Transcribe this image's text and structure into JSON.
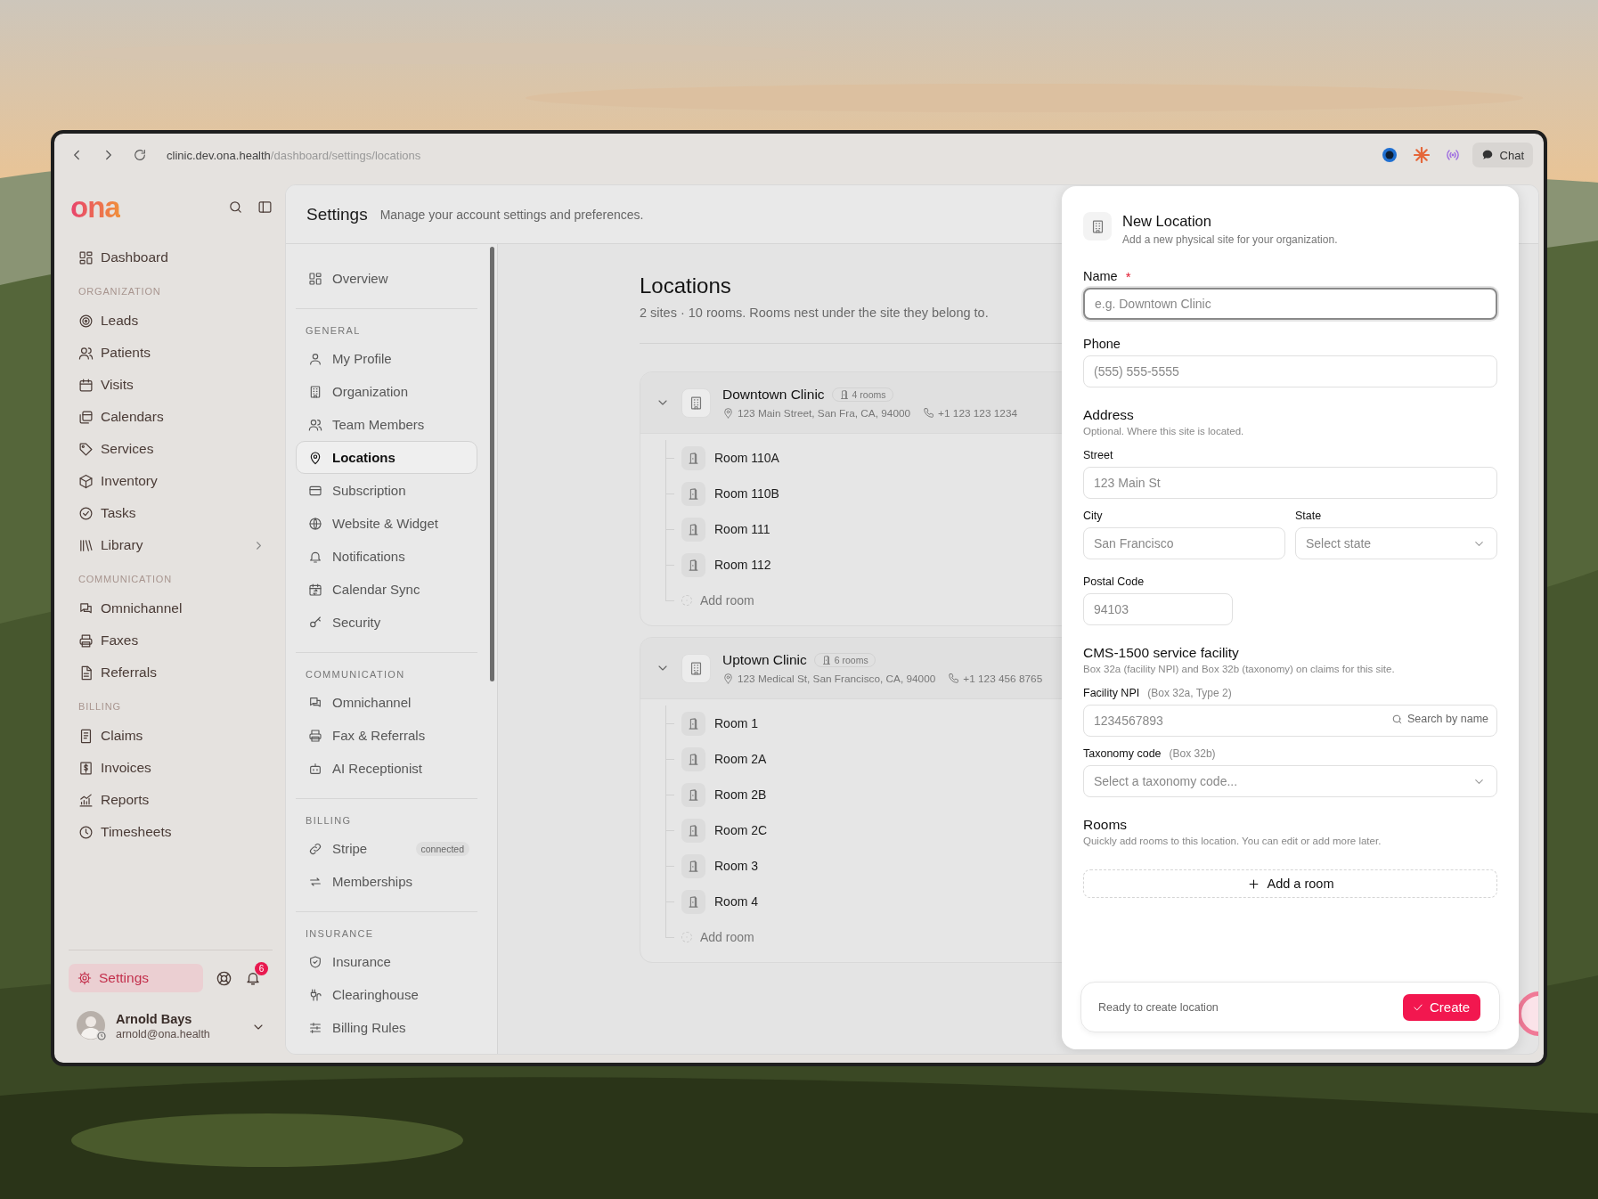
{
  "browser": {
    "url_host": "clinic.dev.ona.health",
    "url_path": "/dashboard/settings/locations",
    "chat_button": "Chat"
  },
  "sidebar": {
    "logo": "ona",
    "sections": [
      {
        "items": [
          {
            "label": "Dashboard",
            "kind": "link"
          }
        ]
      },
      {
        "heading": "ORGANIZATION",
        "items": [
          {
            "label": "Leads",
            "kind": "link"
          },
          {
            "label": "Patients",
            "kind": "link"
          },
          {
            "label": "Visits",
            "kind": "link"
          },
          {
            "label": "Calendars",
            "kind": "link"
          },
          {
            "label": "Services",
            "kind": "link"
          },
          {
            "label": "Inventory",
            "kind": "link"
          },
          {
            "label": "Tasks",
            "kind": "link"
          },
          {
            "label": "Library",
            "kind": "submenu"
          }
        ]
      },
      {
        "heading": "COMMUNICATION",
        "items": [
          {
            "label": "Omnichannel",
            "kind": "link"
          },
          {
            "label": "Faxes",
            "kind": "link"
          },
          {
            "label": "Referrals",
            "kind": "link"
          }
        ]
      },
      {
        "heading": "BILLING",
        "items": [
          {
            "label": "Claims",
            "kind": "link"
          },
          {
            "label": "Invoices",
            "kind": "link"
          },
          {
            "label": "Reports",
            "kind": "link"
          },
          {
            "label": "Timesheets",
            "kind": "link"
          }
        ]
      }
    ],
    "settings": {
      "label": "Settings",
      "selected": true
    },
    "notifications": "6",
    "user": {
      "name": "Arnold Bays",
      "email": "arnold@ona.health"
    }
  },
  "header": {
    "title": "Settings",
    "description": "Manage your account settings and preferences."
  },
  "settings_nav": {
    "sections": [
      {
        "items": [
          {
            "label": "Overview",
            "selected": false
          }
        ]
      },
      {
        "heading": "GENERAL",
        "items": [
          {
            "label": "My Profile",
            "selected": false
          },
          {
            "label": "Organization",
            "selected": false
          },
          {
            "label": "Team Members",
            "selected": false
          },
          {
            "label": "Locations",
            "selected": true
          },
          {
            "label": "Subscription",
            "selected": false
          },
          {
            "label": "Website & Widget",
            "selected": false
          },
          {
            "label": "Notifications",
            "selected": false
          },
          {
            "label": "Calendar Sync",
            "selected": false
          },
          {
            "label": "Security",
            "selected": false
          }
        ]
      },
      {
        "heading": "COMMUNICATION",
        "items": [
          {
            "label": "Omnichannel",
            "selected": false
          },
          {
            "label": "Fax & Referrals",
            "selected": false
          },
          {
            "label": "AI Receptionist",
            "selected": false
          }
        ]
      },
      {
        "heading": "BILLING",
        "items": [
          {
            "label": "Stripe",
            "selected": false,
            "badge": "connected"
          },
          {
            "label": "Memberships",
            "selected": false
          }
        ]
      },
      {
        "heading": "INSURANCE",
        "items": [
          {
            "label": "Insurance",
            "selected": false
          },
          {
            "label": "Clearinghouse",
            "selected": false
          },
          {
            "label": "Billing Rules",
            "selected": false
          }
        ]
      }
    ]
  },
  "locations": {
    "title": "Locations",
    "subtitle": "2 sites · 10 rooms. Rooms nest under the site they belong to.",
    "sites": [
      {
        "name": "Downtown Clinic",
        "room_count": "4 rooms",
        "address": "123 Main Street, San Fra, CA, 94000",
        "phone": "+1 123 123 1234",
        "expanded": true,
        "rooms": [
          "Room 110A",
          "Room 110B",
          "Room 111",
          "Room 112"
        ],
        "add_room": "Add room"
      },
      {
        "name": "Uptown Clinic",
        "room_count": "6 rooms",
        "address": "123 Medical St, San Francisco, CA, 94000",
        "phone": "+1 123 456 8765",
        "expanded": true,
        "rooms": [
          "Room 1",
          "Room 2A",
          "Room 2B",
          "Room 2C",
          "Room 3",
          "Room 4"
        ],
        "add_room": "Add room"
      }
    ]
  },
  "panel": {
    "title": "New Location",
    "subtitle": "Add a new physical site for your organization.",
    "name": {
      "label": "Name",
      "required_mark": "*",
      "placeholder": "e.g. Downtown Clinic",
      "focused": true
    },
    "phone": {
      "label": "Phone",
      "placeholder": "(555) 555-5555"
    },
    "address": {
      "heading": "Address",
      "note": "Optional. Where this site is located.",
      "street": {
        "label": "Street",
        "placeholder": "123 Main St"
      },
      "city": {
        "label": "City",
        "placeholder": "San Francisco"
      },
      "state": {
        "label": "State",
        "placeholder": "Select state"
      },
      "postal_code": {
        "label": "Postal Code",
        "placeholder": "94103"
      }
    },
    "facility": {
      "heading": "CMS-1500 service facility",
      "note": "Box 32a (facility NPI) and Box 32b (taxonomy) on claims for this site.",
      "npi": {
        "label": "Facility NPI",
        "hint": "(Box 32a, Type 2)",
        "placeholder": "1234567893",
        "search": "Search by name"
      },
      "taxonomy": {
        "label": "Taxonomy code",
        "hint": "(Box 32b)",
        "placeholder": "Select a taxonomy code..."
      }
    },
    "rooms": {
      "heading": "Rooms",
      "note": "Quickly add rooms to this location. You can edit or add more later.",
      "add": "Add a room"
    },
    "footer": {
      "status": "Ready to create location",
      "create": "Create"
    }
  }
}
